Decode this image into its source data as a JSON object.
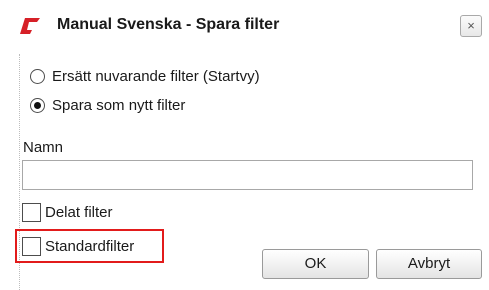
{
  "window": {
    "title": "Manual Svenska - Spara filter",
    "logo_icon": "app-logo-icon",
    "close_label": "×",
    "brand_color": "#d62027"
  },
  "options": {
    "replace_label": "Ersätt nuvarande filter (Startvy)",
    "replace_checked": false,
    "save_new_label": "Spara som nytt filter",
    "save_new_checked": true
  },
  "name_field": {
    "label": "Namn",
    "value": ""
  },
  "checkboxes": {
    "shared_label": "Delat filter",
    "shared_checked": false,
    "default_label": "Standardfilter",
    "default_checked": false,
    "highlight_color": "#e21b1b"
  },
  "buttons": {
    "ok_label": "OK",
    "cancel_label": "Avbryt"
  }
}
